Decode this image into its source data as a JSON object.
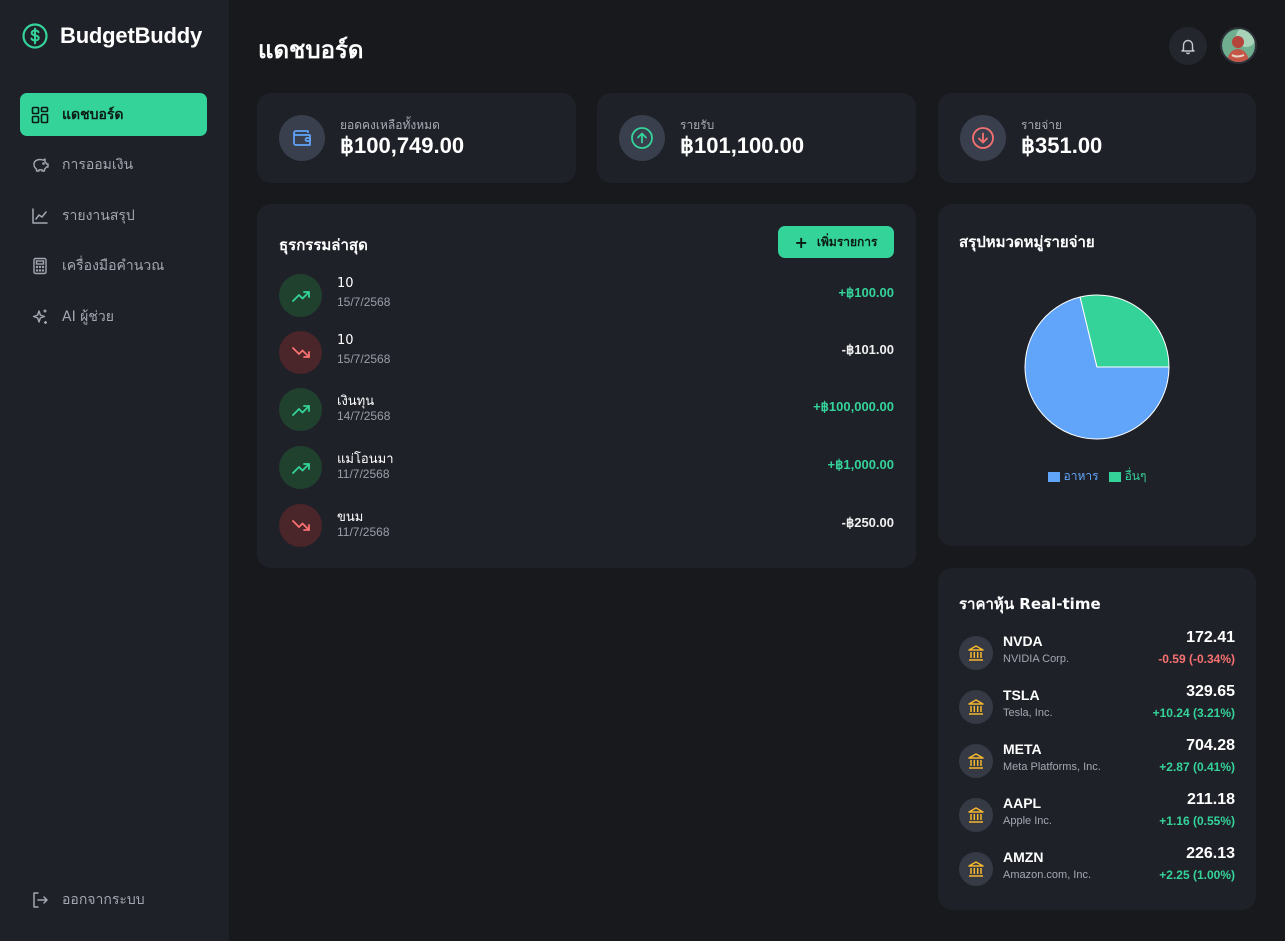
{
  "app": {
    "name": "BudgetBuddy"
  },
  "sidebar": {
    "items": [
      {
        "label": "แดชบอร์ด",
        "icon": "dashboard-icon",
        "active": true
      },
      {
        "label": "การออมเงิน",
        "icon": "piggy-bank-icon",
        "active": false
      },
      {
        "label": "รายงานสรุป",
        "icon": "chart-icon",
        "active": false
      },
      {
        "label": "เครื่องมือคำนวณ",
        "icon": "calculator-icon",
        "active": false
      },
      {
        "label": "AI ผู้ช่วย",
        "icon": "sparkles-icon",
        "active": false
      }
    ],
    "logout_label": "ออกจากระบบ"
  },
  "header": {
    "title": "แดชบอร์ด"
  },
  "stats": [
    {
      "label": "ยอดคงเหลือทั้งหมด",
      "value": "฿100,749.00",
      "icon": "wallet-icon",
      "color": "#60a5fa"
    },
    {
      "label": "รายรับ",
      "value": "฿101,100.00",
      "icon": "arrow-up-circle-icon",
      "color": "#34d399"
    },
    {
      "label": "รายจ่าย",
      "value": "฿351.00",
      "icon": "arrow-down-circle-icon",
      "color": "#f87171"
    }
  ],
  "transactions": {
    "title": "ธุรกรรมล่าสุด",
    "add_label": "เพิ่มรายการ",
    "items": [
      {
        "name": "10",
        "date": "15/7/2568",
        "amount": "+฿100.00",
        "type": "in"
      },
      {
        "name": "10",
        "date": "15/7/2568",
        "amount": "-฿101.00",
        "type": "out"
      },
      {
        "name": "เงินทุน",
        "date": "14/7/2568",
        "amount": "+฿100,000.00",
        "type": "in"
      },
      {
        "name": "แม่โอนมา",
        "date": "11/7/2568",
        "amount": "+฿1,000.00",
        "type": "in"
      },
      {
        "name": "ขนม",
        "date": "11/7/2568",
        "amount": "-฿250.00",
        "type": "out"
      }
    ]
  },
  "expense_chart": {
    "title": "สรุปหมวดหมู่รายจ่าย",
    "colors": {
      "food": "#60a5fa",
      "other": "#34d399"
    }
  },
  "chart_data": {
    "type": "pie",
    "categories": [
      "อาหาร",
      "อื่นๆ"
    ],
    "values": [
      250,
      101
    ]
  },
  "stocks": {
    "title": "ราคาหุ้น Real-time",
    "items": [
      {
        "symbol": "NVDA",
        "name": "NVIDIA Corp.",
        "price": "172.41",
        "change": "-0.59 (-0.34%)",
        "direction": "down"
      },
      {
        "symbol": "TSLA",
        "name": "Tesla, Inc.",
        "price": "329.65",
        "change": "+10.24 (3.21%)",
        "direction": "up"
      },
      {
        "symbol": "META",
        "name": "Meta Platforms, Inc.",
        "price": "704.28",
        "change": "+2.87 (0.41%)",
        "direction": "up"
      },
      {
        "symbol": "AAPL",
        "name": "Apple Inc.",
        "price": "211.18",
        "change": "+1.16 (0.55%)",
        "direction": "up"
      },
      {
        "symbol": "AMZN",
        "name": "Amazon.com, Inc.",
        "price": "226.13",
        "change": "+2.25 (1.00%)",
        "direction": "up"
      }
    ]
  }
}
